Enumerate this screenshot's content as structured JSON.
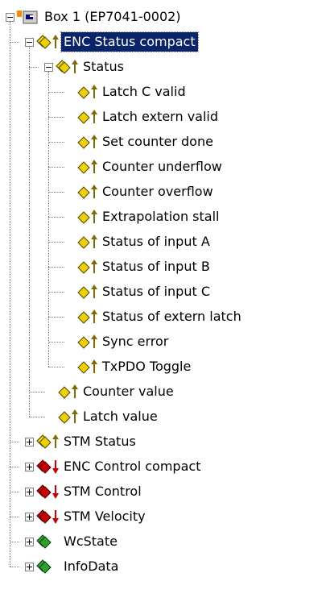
{
  "tree": [
    {
      "label": "Box 1 (EP7041-0002)",
      "icon": "box-icon",
      "depth": 0,
      "expander": "minus",
      "selected": false
    },
    {
      "label": "ENC Status compact",
      "icon": "input-var-group-icon",
      "depth": 1,
      "expander": "minus",
      "selected": true
    },
    {
      "label": "Status",
      "icon": "input-var-group-icon",
      "depth": 2,
      "expander": "minus",
      "selected": false
    },
    {
      "label": "Latch C valid",
      "icon": "input-var-icon",
      "depth": 3,
      "expander": "none",
      "selected": false
    },
    {
      "label": "Latch extern valid",
      "icon": "input-var-icon",
      "depth": 3,
      "expander": "none",
      "selected": false
    },
    {
      "label": "Set counter done",
      "icon": "input-var-icon",
      "depth": 3,
      "expander": "none",
      "selected": false
    },
    {
      "label": "Counter underflow",
      "icon": "input-var-icon",
      "depth": 3,
      "expander": "none",
      "selected": false
    },
    {
      "label": "Counter overflow",
      "icon": "input-var-icon",
      "depth": 3,
      "expander": "none",
      "selected": false
    },
    {
      "label": "Extrapolation stall",
      "icon": "input-var-icon",
      "depth": 3,
      "expander": "none",
      "selected": false
    },
    {
      "label": "Status of input A",
      "icon": "input-var-icon",
      "depth": 3,
      "expander": "none",
      "selected": false
    },
    {
      "label": "Status of input B",
      "icon": "input-var-icon",
      "depth": 3,
      "expander": "none",
      "selected": false
    },
    {
      "label": "Status of input C",
      "icon": "input-var-icon",
      "depth": 3,
      "expander": "none",
      "selected": false
    },
    {
      "label": "Status of extern latch",
      "icon": "input-var-icon",
      "depth": 3,
      "expander": "none",
      "selected": false
    },
    {
      "label": "Sync error",
      "icon": "input-var-icon",
      "depth": 3,
      "expander": "none",
      "selected": false
    },
    {
      "label": "TxPDO Toggle",
      "icon": "input-var-icon",
      "depth": 3,
      "expander": "none",
      "selected": false
    },
    {
      "label": "Counter value",
      "icon": "input-var-icon",
      "depth": 2,
      "expander": "none",
      "selected": false
    },
    {
      "label": "Latch value",
      "icon": "input-var-icon",
      "depth": 2,
      "expander": "none",
      "selected": false
    },
    {
      "label": "STM Status",
      "icon": "input-var-group-icon",
      "depth": 1,
      "expander": "plus",
      "selected": false
    },
    {
      "label": "ENC Control compact",
      "icon": "output-var-group-icon",
      "depth": 1,
      "expander": "plus",
      "selected": false
    },
    {
      "label": "STM Control",
      "icon": "output-var-group-icon",
      "depth": 1,
      "expander": "plus",
      "selected": false
    },
    {
      "label": "STM Velocity",
      "icon": "output-var-group-icon",
      "depth": 1,
      "expander": "plus",
      "selected": false
    },
    {
      "label": "WcState",
      "icon": "state-group-icon",
      "depth": 1,
      "expander": "plus",
      "selected": false
    },
    {
      "label": "InfoData",
      "icon": "state-group-icon",
      "depth": 1,
      "expander": "plus",
      "selected": false
    }
  ],
  "colors": {
    "selection_bg": "#0a246a",
    "selection_fg": "#ffffff",
    "tree_lines": "#808080",
    "input_icon": "#f0d000",
    "output_icon": "#cc0000",
    "state_icon": "#2ea02e"
  }
}
